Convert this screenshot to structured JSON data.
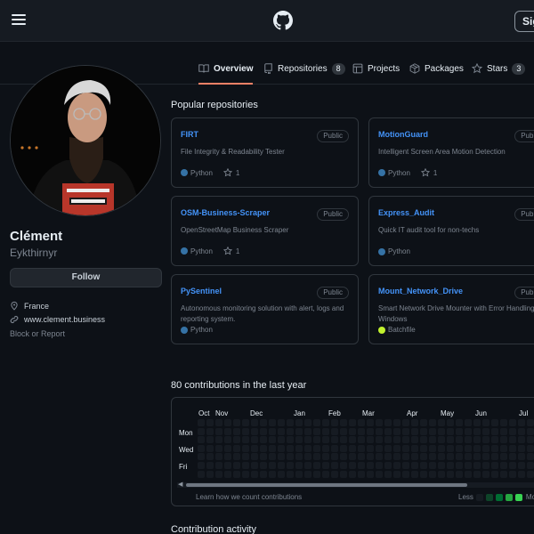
{
  "header": {
    "signin_label": "Sig"
  },
  "tabs": [
    {
      "label": "Overview",
      "icon": "book-icon"
    },
    {
      "label": "Repositories",
      "count": "8",
      "icon": "repo-icon"
    },
    {
      "label": "Projects",
      "icon": "table-icon"
    },
    {
      "label": "Packages",
      "icon": "package-icon"
    },
    {
      "label": "Stars",
      "count": "3",
      "icon": "star-icon"
    }
  ],
  "profile": {
    "fullname": "Clément",
    "username": "Eykthirnyr",
    "follow_label": "Follow",
    "location": "France",
    "website": "www.clement.business",
    "block_label": "Block or Report"
  },
  "popular": {
    "title": "Popular repositories",
    "repos": [
      {
        "name": "FIRT",
        "visibility": "Public",
        "desc": "File Integrity & Readability Tester",
        "lang": "Python",
        "lang_color": "#3572A5",
        "stars": "1"
      },
      {
        "name": "MotionGuard",
        "visibility": "Public",
        "desc": "Intelligent Screen Area Motion Detection",
        "lang": "Python",
        "lang_color": "#3572A5",
        "stars": "1"
      },
      {
        "name": "OSM-Business-Scraper",
        "visibility": "Public",
        "desc": "OpenStreetMap Business Scraper",
        "lang": "Python",
        "lang_color": "#3572A5",
        "stars": "1"
      },
      {
        "name": "Express_Audit",
        "visibility": "Public",
        "desc": "Quick IT audit tool for non-techs",
        "lang": "Python",
        "lang_color": "#3572A5"
      },
      {
        "name": "PySentinel",
        "visibility": "Public",
        "desc": "Autonomous monitoring solution with alert, logs and reporting system.",
        "lang": "Python",
        "lang_color": "#3572A5"
      },
      {
        "name": "Mount_Network_Drive",
        "visibility": "Public",
        "desc": "Smart Network Drive Mounter with Error Handling for Windows",
        "lang": "Batchfile",
        "lang_color": "#C1F12E"
      }
    ]
  },
  "contributions": {
    "title": "80 contributions in the last year",
    "months": [
      "Oct",
      "Nov",
      "Dec",
      "Jan",
      "Feb",
      "Mar",
      "Apr",
      "May",
      "Jun",
      "Jul"
    ],
    "days": [
      "Mon",
      "Wed",
      "Fri"
    ],
    "learn_label": "Learn how we count contributions",
    "less_label": "Less",
    "more_label": "More",
    "legend_colors": [
      "#161b22",
      "#0e4429",
      "#006d32",
      "#26a641",
      "#39d353"
    ]
  },
  "activity": {
    "title": "Contribution activity"
  }
}
